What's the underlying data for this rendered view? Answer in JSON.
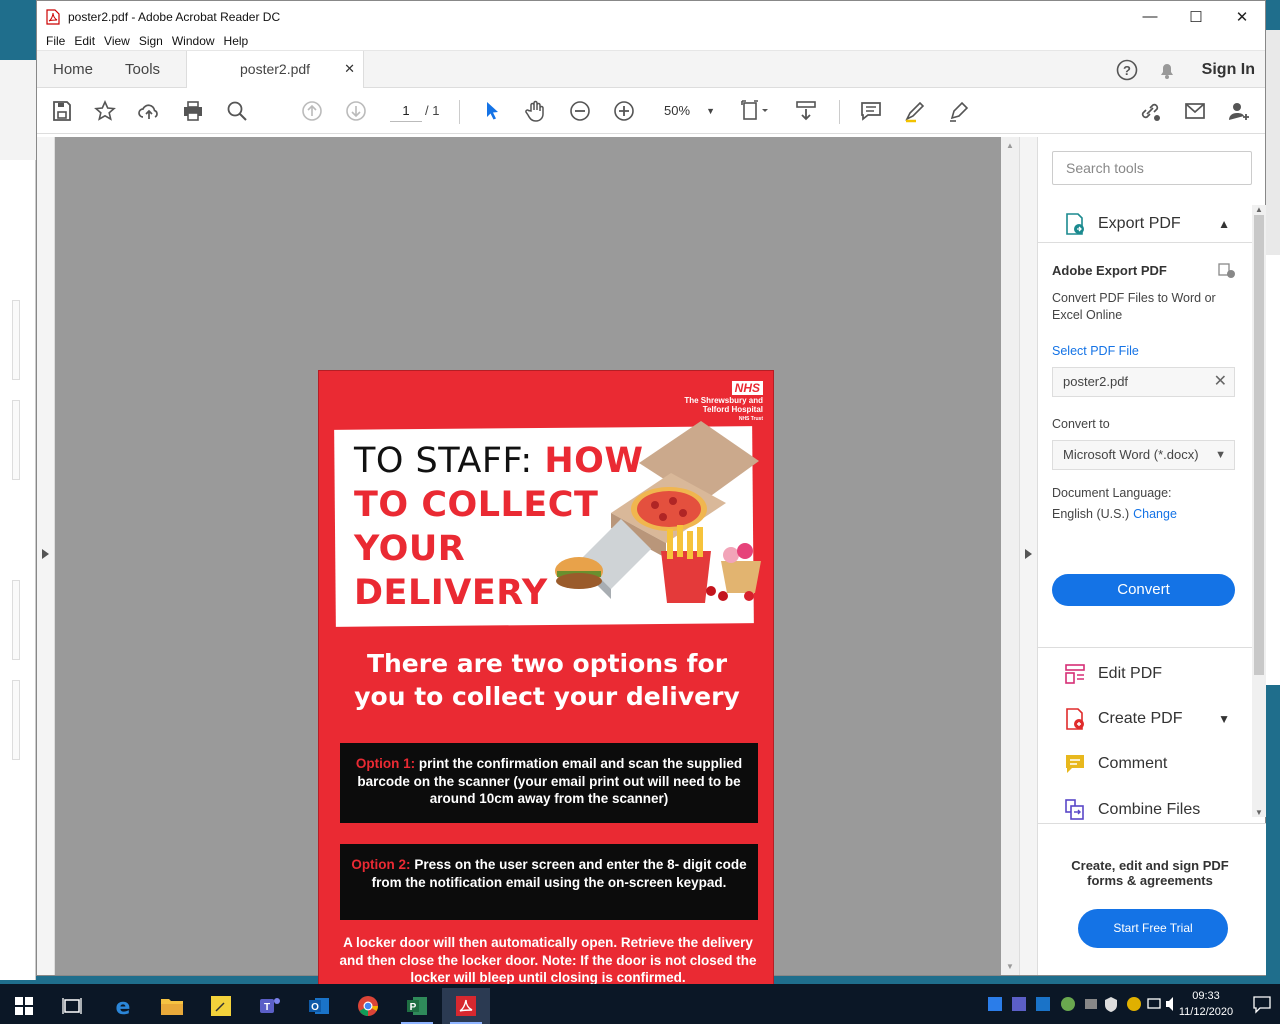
{
  "window": {
    "title": "poster2.pdf - Adobe Acrobat Reader DC"
  },
  "menu": [
    "File",
    "Edit",
    "View",
    "Sign",
    "Window",
    "Help"
  ],
  "tabs": {
    "home": "Home",
    "tools": "Tools",
    "doc": "poster2.pdf"
  },
  "header": {
    "signin": "Sign In"
  },
  "toolbar": {
    "page_current": "1",
    "page_total": "/ 1",
    "zoom": "50%"
  },
  "poster": {
    "nhs": "NHS",
    "hospital": "The Shrewsbury and Telford Hospital",
    "trust": "NHS Trust",
    "headline_black": "TO STAFF: ",
    "headline_red": "HOW TO COLLECT YOUR DELIVERY",
    "subtitle": "There are two options for you to collect your delivery",
    "option1_label": "Option 1:",
    "option1_text": " print the confirmation email and scan the supplied barcode on the scanner (your email print out will need to be around 10cm away from the scanner)",
    "option2_label": "Option 2:",
    "option2_text": " Press on the user screen and enter the 8- digit code from the notification email using the on-screen keypad.",
    "footer": "A locker door will then automatically open. Retrieve the delivery and then close the locker door. Note: If the door is not closed the locker will bleep until closing is confirmed."
  },
  "panel": {
    "search_placeholder": "Search tools",
    "export_label": "Export PDF",
    "aep_title": "Adobe Export PDF",
    "aep_desc": "Convert PDF Files to Word or Excel Online",
    "select_label": "Select PDF File",
    "file_name": "poster2.pdf",
    "convert_to_label": "Convert to",
    "convert_to_value": "Microsoft Word (*.docx)",
    "lang_label": "Document Language:",
    "lang_value": "English (U.S.)",
    "lang_change": "Change",
    "convert_button": "Convert",
    "tools": [
      "Edit PDF",
      "Create PDF",
      "Comment",
      "Combine Files"
    ],
    "promo_text": "Create, edit and sign PDF forms & agreements",
    "trial_button": "Start Free Trial"
  },
  "taskbar": {
    "time": "09:33",
    "date": "11/12/2020"
  },
  "colors": {
    "accent": "#1473e6",
    "poster_red": "#ea2a33",
    "taskbar": "#0b1726"
  }
}
